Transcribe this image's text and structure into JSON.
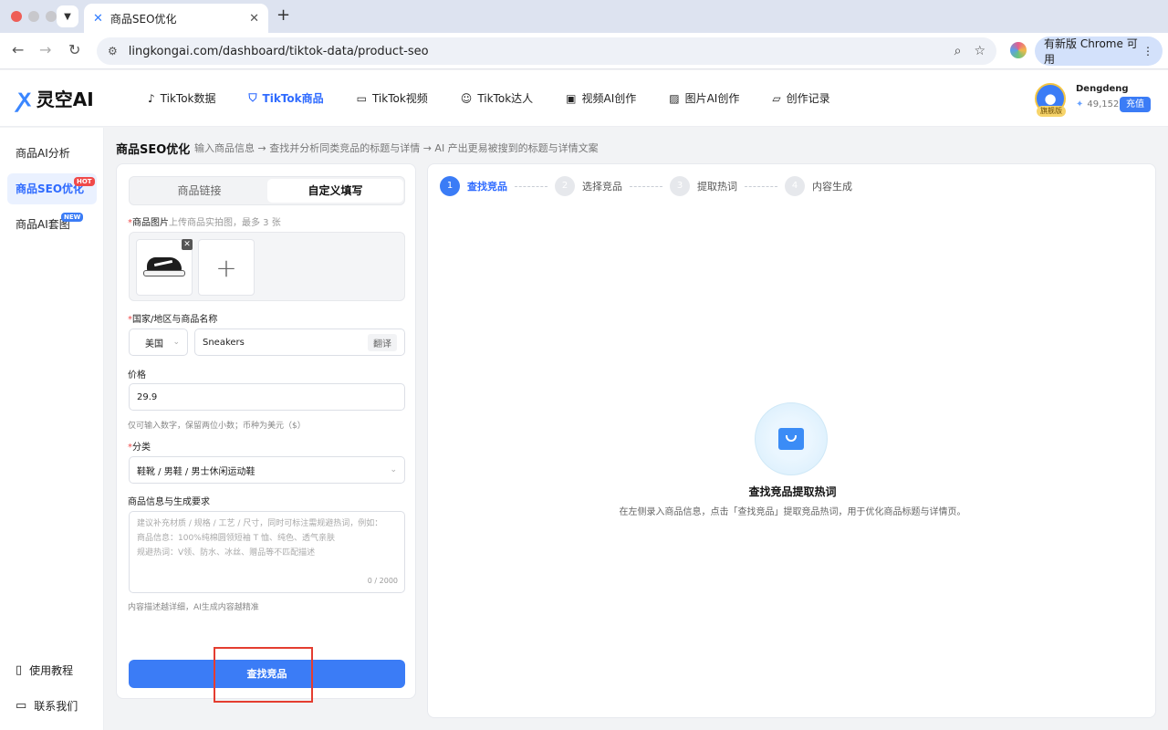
{
  "browser": {
    "tab_title": "商品SEO优化",
    "url": "lingkongai.com/dashboard/tiktok-data/product-seo",
    "update_button": "有新版 Chrome 可用"
  },
  "app": {
    "logo_text": "灵空AI",
    "nav": [
      {
        "label": "TikTok数据",
        "icon": "tiktok-icon"
      },
      {
        "label": "TikTok商品",
        "icon": "bag-icon",
        "active": true
      },
      {
        "label": "TikTok视频",
        "icon": "video-icon"
      },
      {
        "label": "TikTok达人",
        "icon": "users-icon"
      },
      {
        "label": "视频AI创作",
        "icon": "film-icon"
      },
      {
        "label": "图片AI创作",
        "icon": "image-icon"
      },
      {
        "label": "创作记录",
        "icon": "folder-icon"
      }
    ],
    "user": {
      "name": "Dengdeng",
      "badge": "旗舰版",
      "points": "49,152",
      "recharge": "充值"
    }
  },
  "sidebar": {
    "items": [
      {
        "label": "商品AI分析"
      },
      {
        "label": "商品SEO优化",
        "tag": "HOT",
        "active": true
      },
      {
        "label": "商品AI套图",
        "tag": "NEW"
      }
    ],
    "bottom": [
      {
        "label": "使用教程",
        "icon": "book-icon"
      },
      {
        "label": "联系我们",
        "icon": "chat-icon"
      }
    ]
  },
  "page": {
    "title": "商品SEO优化",
    "description": "输入商品信息 → 查找并分析同类竞品的标题与详情 → AI 产出更易被搜到的标题与详情文案"
  },
  "form": {
    "tabs": [
      "商品链接",
      "自定义填写"
    ],
    "image_label": "商品图片",
    "image_hint": "上传商品实拍图，最多 3 张",
    "country_label": "国家/地区与商品名称",
    "country_value": "美国",
    "product_name": "Sneakers",
    "translate": "翻译",
    "price_label": "价格",
    "price_value": "29.9",
    "price_help": "仅可输入数字，保留两位小数；币种为美元（$）",
    "category_label": "分类",
    "category_value": "鞋靴 / 男鞋 / 男士休闲运动鞋",
    "info_label": "商品信息与生成要求",
    "info_placeholder": [
      "建议补充材质 / 规格 / 工艺 / 尺寸，同时可标注需规避热词，例如：",
      "商品信息：100%纯棉圆领短袖 T 恤、纯色、透气亲肤",
      "规避热词：V领、防水、冰丝、赠品等不匹配描述"
    ],
    "info_count": "0 / 2000",
    "info_help": "内容描述越详细，AI生成内容越精准",
    "submit": "查找竞品"
  },
  "steps": [
    {
      "num": "1",
      "label": "查找竞品",
      "active": true
    },
    {
      "num": "2",
      "label": "选择竞品"
    },
    {
      "num": "3",
      "label": "提取热词"
    },
    {
      "num": "4",
      "label": "内容生成"
    }
  ],
  "empty_state": {
    "title": "查找竞品提取热词",
    "description": "在左侧录入商品信息，点击「查找竞品」提取竞品热词，用于优化商品标题与详情页。"
  }
}
